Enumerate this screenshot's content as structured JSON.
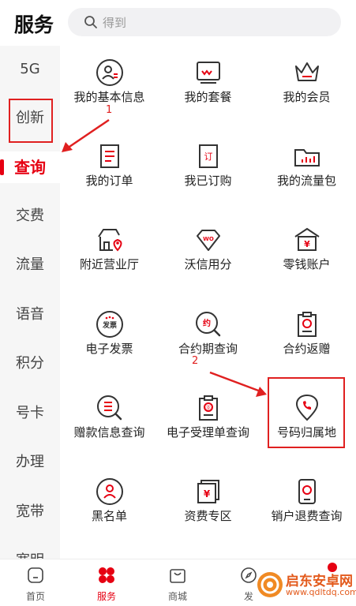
{
  "header": {
    "title": "服务",
    "search_placeholder": "得到"
  },
  "sidebar": {
    "items": [
      "5G",
      "创新",
      "查询",
      "交费",
      "流量",
      "语音",
      "积分",
      "号卡",
      "办理",
      "宽带",
      "宽明"
    ],
    "active": "查询"
  },
  "grid": {
    "items": [
      {
        "label": "我的基本信息",
        "icon": "user-info-icon"
      },
      {
        "label": "我的套餐",
        "icon": "package-icon"
      },
      {
        "label": "我的会员",
        "icon": "crown-icon"
      },
      {
        "label": "我的订单",
        "icon": "order-icon"
      },
      {
        "label": "我已订购",
        "icon": "subscribed-icon"
      },
      {
        "label": "我的流量包",
        "icon": "data-package-icon"
      },
      {
        "label": "附近营业厅",
        "icon": "store-location-icon"
      },
      {
        "label": "沃信用分",
        "icon": "diamond-icon"
      },
      {
        "label": "零钱账户",
        "icon": "wallet-icon"
      },
      {
        "label": "电子发票",
        "icon": "invoice-icon"
      },
      {
        "label": "合约期查询",
        "icon": "contract-search-icon"
      },
      {
        "label": "合约返赠",
        "icon": "contract-gift-icon"
      },
      {
        "label": "赠款信息查询",
        "icon": "grant-info-icon"
      },
      {
        "label": "电子受理单查询",
        "icon": "receipt-icon"
      },
      {
        "label": "号码归属地",
        "icon": "phone-location-icon"
      },
      {
        "label": "黑名单",
        "icon": "blacklist-icon"
      },
      {
        "label": "资费专区",
        "icon": "tariff-icon"
      },
      {
        "label": "销户退费查询",
        "icon": "refund-icon"
      }
    ],
    "icon_inner": {
      "invoice": "发票",
      "receipt": "⓪",
      "subscribed": "订",
      "contract": "约",
      "wallet": "¥",
      "tariff": "¥",
      "diamond": "WO"
    }
  },
  "annotations": {
    "step1": "1",
    "step2": "2"
  },
  "tabbar": {
    "items": [
      "首页",
      "服务",
      "商城",
      "发"
    ],
    "active": "服务"
  },
  "watermark": {
    "name": "启东安卓网",
    "url": "www.qdltdq.com"
  },
  "colors": {
    "accent": "#e60012",
    "annotation": "#e02020"
  }
}
